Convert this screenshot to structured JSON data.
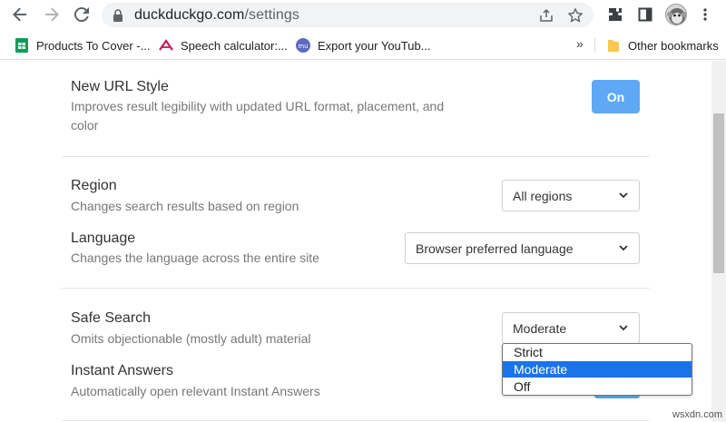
{
  "browser": {
    "url_host": "duckduckgo.com",
    "url_path": "/settings",
    "bookmarks": [
      {
        "label": "Products To Cover -...",
        "icon": "google-sheets-icon"
      },
      {
        "label": "Speech calculator:...",
        "icon": "speech-calculator-icon"
      },
      {
        "label": "Export your YouTub...",
        "icon": "my-app-icon"
      }
    ],
    "overflow_label": "»",
    "other_bookmarks": "Other bookmarks"
  },
  "settings": {
    "url_style": {
      "title": "New URL Style",
      "description_line1": "Improves result legibility with updated URL format, placement, and",
      "description_line2": "color",
      "toggle_label": "On"
    },
    "region": {
      "title": "Region",
      "description": "Changes search results based on region",
      "value": "All regions"
    },
    "language": {
      "title": "Language",
      "description": "Changes the language across the entire site",
      "value": "Browser preferred language"
    },
    "safe_search": {
      "title": "Safe Search",
      "description": "Omits objectionable (mostly adult) material",
      "value": "Moderate",
      "options": [
        "Strict",
        "Moderate",
        "Off"
      ],
      "selected_index": 1
    },
    "instant_answers": {
      "title": "Instant Answers",
      "description": "Automatically open relevant Instant Answers"
    }
  },
  "colors": {
    "accent": "#5ea8f5",
    "selected_option": "#1a73e8"
  },
  "watermark": "wsxdn.com"
}
